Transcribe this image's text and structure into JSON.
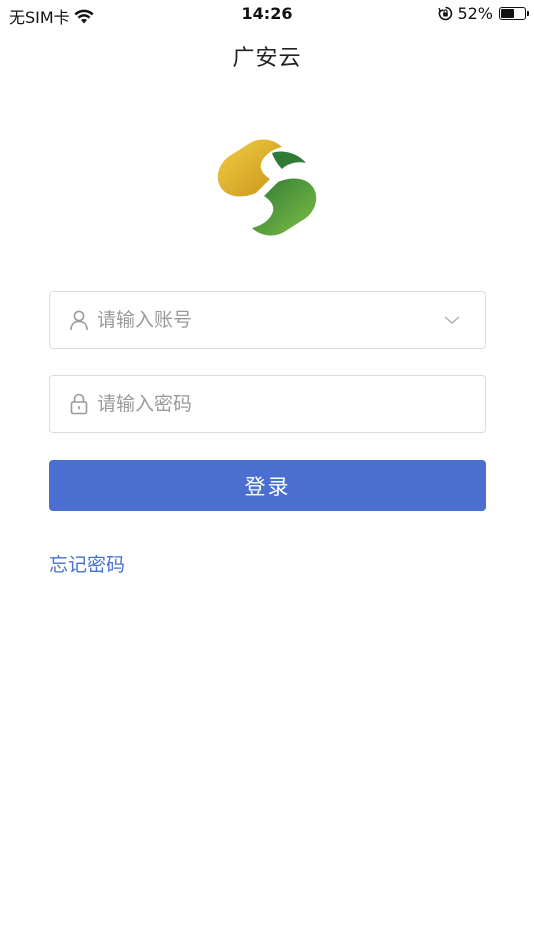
{
  "status_bar": {
    "carrier": "无SIM卡",
    "time": "14:26",
    "battery_percent": "52%",
    "battery_level": 0.52,
    "icons": [
      "wifi-icon",
      "orientation-lock-icon",
      "battery-icon"
    ]
  },
  "header": {
    "title": "广安云"
  },
  "login_form": {
    "account_placeholder": "请输入账号",
    "password_placeholder": "请输入密码",
    "login_label": "登录",
    "forgot_password_label": "忘记密码"
  },
  "colors": {
    "accent": "#4a6fd1",
    "logo_yellow": "#e5b52c",
    "logo_green": "#4b9a3b"
  }
}
